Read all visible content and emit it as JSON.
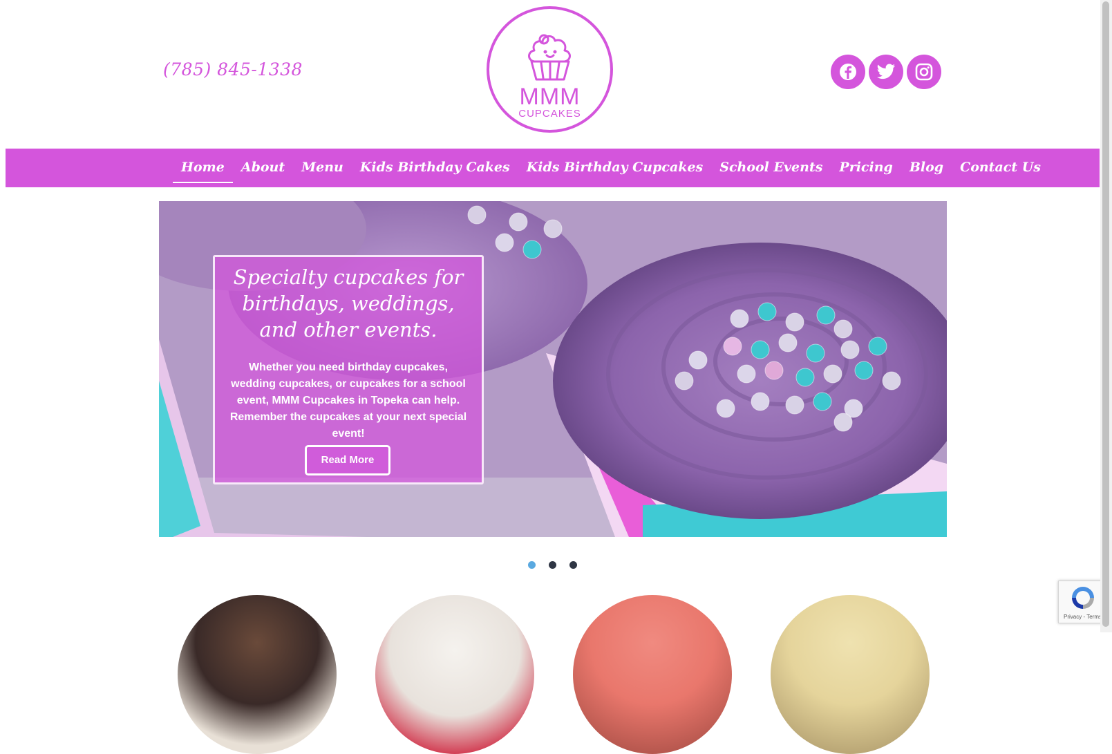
{
  "header": {
    "phone": "(785) 845-1338",
    "logo": {
      "line1": "MMM",
      "line2": "CUPCAKES",
      "icon": "cupcake-icon"
    },
    "social": [
      {
        "name": "facebook",
        "icon": "facebook-icon"
      },
      {
        "name": "twitter",
        "icon": "twitter-icon"
      },
      {
        "name": "instagram",
        "icon": "instagram-icon"
      }
    ]
  },
  "nav": {
    "items": [
      {
        "label": "Home",
        "active": true
      },
      {
        "label": "About"
      },
      {
        "label": "Menu"
      },
      {
        "label": "Kids Birthday Cakes"
      },
      {
        "label": "Kids Birthday Cupcakes"
      },
      {
        "label": "School Events"
      },
      {
        "label": "Pricing"
      },
      {
        "label": "Blog"
      },
      {
        "label": "Contact Us"
      }
    ]
  },
  "hero": {
    "heading": "Specialty cupcakes for birthdays, weddings, and other events.",
    "body": "Whether you need birthday cupcakes, wedding cupcakes, or cupcakes for a school event, MMM Cupcakes in Topeka can help. Remember the cupcakes at your next special event!",
    "button": "Read More",
    "slide_count": 3,
    "active_slide": 1
  },
  "recaptcha": {
    "links": "Privacy - Terms"
  },
  "colors": {
    "brand": "#d455dc",
    "dot_active": "#5aa9e0",
    "dot": "#2f3644"
  }
}
